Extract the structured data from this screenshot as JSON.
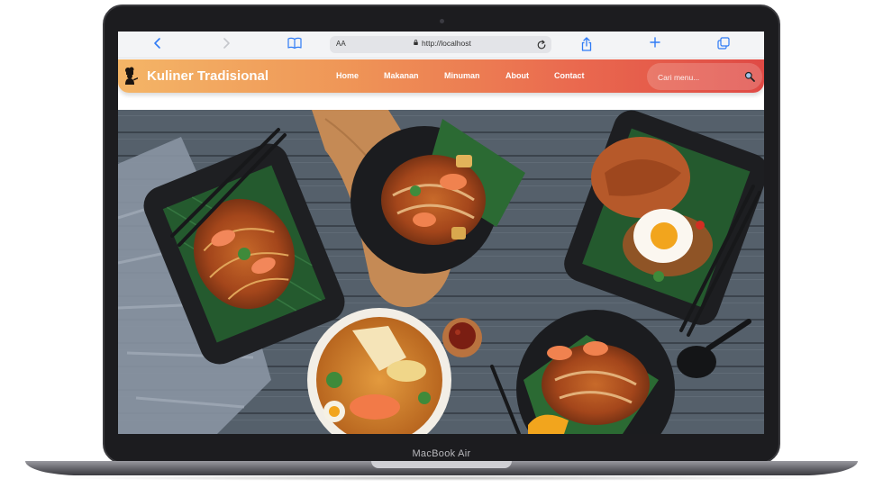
{
  "device": {
    "label": "MacBook Air"
  },
  "browser": {
    "text_size_label": "AA",
    "url": "http://localhost"
  },
  "site": {
    "brand": "Kuliner Tradisional",
    "nav": [
      {
        "label": "Home"
      },
      {
        "label": "Makanan"
      },
      {
        "label": "Minuman"
      },
      {
        "label": "About"
      },
      {
        "label": "Contact"
      }
    ],
    "search": {
      "placeholder": "Cari menu..."
    }
  },
  "colors": {
    "nav_gradient_start": "#f4b567",
    "nav_gradient_end": "#df4a45",
    "browser_accent": "#2f7bf5"
  },
  "icons": {
    "back": "chevron-left-icon",
    "forward": "chevron-right-icon",
    "bookmarks": "open-book-icon",
    "share": "share-icon",
    "new_tab": "plus-icon",
    "tabs": "tabs-icon",
    "reload": "reload-icon",
    "lock": "lock-icon",
    "search": "magnifier-icon",
    "logo": "chef-silhouette-icon"
  }
}
